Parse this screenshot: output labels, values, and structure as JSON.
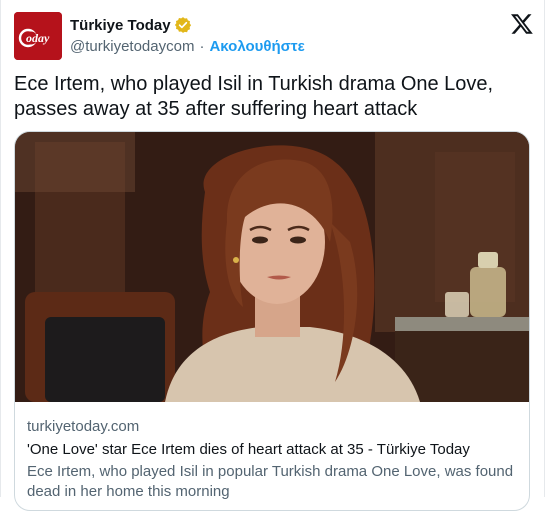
{
  "account": {
    "display_name": "Türkiye Today",
    "handle": "@turkiyetodaycom",
    "separator": "·",
    "follow_label": "Ακολουθήστε",
    "avatar_text": "Today",
    "verified_color": "#e2b719"
  },
  "tweet": {
    "text": "Ece Irtem, who played Isil in Turkish drama One Love, passes away at 35 after suffering heart attack"
  },
  "card": {
    "domain": "turkiyetoday.com",
    "title": "'One Love' star Ece Irtem dies of heart attack at 35 - Türkiye Today",
    "description": "Ece Irtem, who played Isil in popular Turkish drama One Love, was found dead in her home this morning"
  },
  "colors": {
    "brand_red": "#b5121b",
    "link_blue": "#1d9bf0",
    "muted_text": "#536471"
  },
  "icons": [
    "verified-badge-icon",
    "x-logo-icon"
  ]
}
